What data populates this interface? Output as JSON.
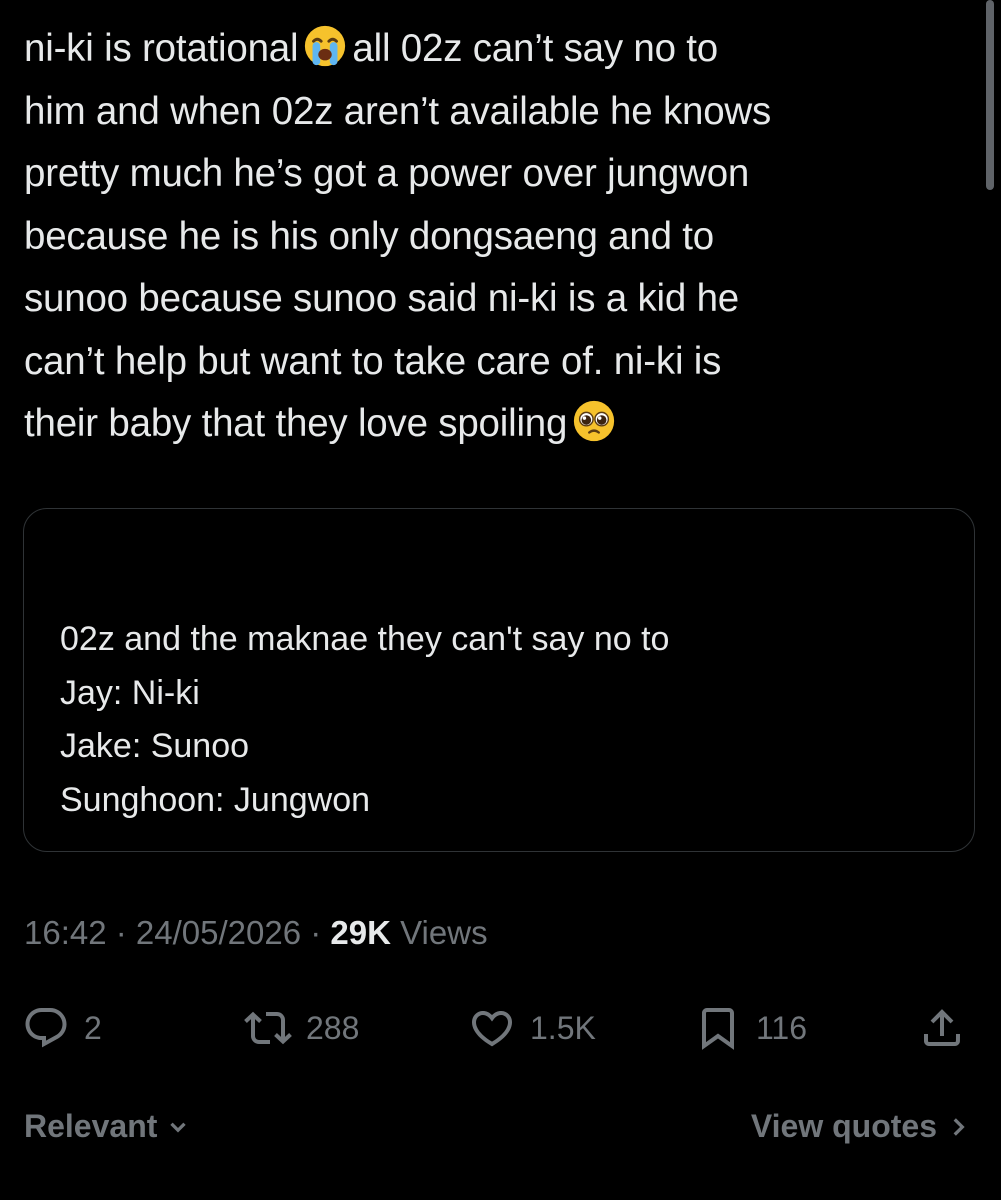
{
  "tweet": {
    "lines": [
      "ni-ki is rotational",
      "all 02z can’t say no to",
      "him and when 02z aren’t available he knows",
      "pretty much he’s got a power over jungwon",
      "because he is his only dongsaeng and to",
      "sunoo because sunoo said ni-ki is a kid he",
      "can’t help but want to take care of. ni-ki is",
      "their baby that they love spoiling"
    ],
    "emojis": [
      "loudly-crying-face-emoji",
      "pleading-face-emoji"
    ]
  },
  "quote": {
    "lines": [
      "02z and the maknae they can't say no to",
      "Jay: Ni-ki",
      "Jake: Sunoo",
      "Sunghoon: Jungwon"
    ]
  },
  "meta": {
    "time": "16:42",
    "separator": " · ",
    "date": "24/05/2026",
    "views_count": "29K",
    "views_label": " Views"
  },
  "actions": {
    "replies": "2",
    "reposts": "288",
    "likes": "1.5K",
    "bookmarks": "116"
  },
  "footer": {
    "sort_label": "Relevant",
    "view_quotes_label": "View quotes"
  },
  "colors": {
    "background": "#000000",
    "text": "#e7e9ea",
    "secondary": "#71767b",
    "border": "#2f3336"
  }
}
